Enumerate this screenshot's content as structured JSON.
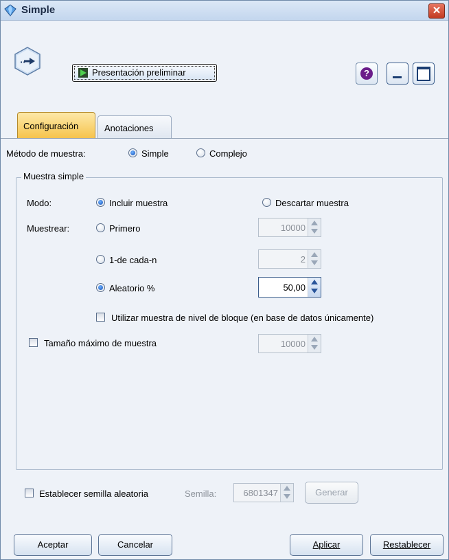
{
  "window": {
    "title": "Simple"
  },
  "toolbar": {
    "preview_label": "Presentación preliminar",
    "help_symbol": "?"
  },
  "tabs": [
    {
      "label": "Configuración",
      "active": true
    },
    {
      "label": "Anotaciones",
      "active": false
    }
  ],
  "method": {
    "label": "Método de muestra:",
    "options": [
      "Simple",
      "Complejo"
    ],
    "selected": "Simple"
  },
  "simple_sample": {
    "group_title": "Muestra simple",
    "mode_label": "Modo:",
    "mode_include": "Incluir muestra",
    "mode_discard": "Descartar muestra",
    "sample_label": "Muestrear:",
    "first_label": "Primero",
    "first_value": "10000",
    "nth_label": "1-de cada-n",
    "nth_value": "2",
    "random_label": "Aleatorio %",
    "random_value": "50,00",
    "block_level_label": "Utilizar muestra de nivel de bloque (en base de datos únicamente)",
    "max_size_label": "Tamaño máximo de muestra",
    "max_size_value": "10000"
  },
  "seed": {
    "checkbox_label": "Establecer semilla aleatoria",
    "seed_label": "Semilla:",
    "seed_value": "6801347",
    "generate_label": "Generar"
  },
  "buttons": {
    "accept": "Aceptar",
    "cancel": "Cancelar",
    "apply": "Aplicar",
    "reset": "Restablecer"
  },
  "icons": {
    "app": "diamond-app-icon",
    "node": "sample-node-icon",
    "preview": "play-icon",
    "help": "help-icon",
    "minimize": "minimize-icon",
    "maximize": "maximize-icon",
    "close": "close-icon"
  },
  "colors": {
    "active_tab": "#f6c24a",
    "close_button": "#c23b22",
    "radio_selected": "#1450b8",
    "help_icon": "#6b1d8a"
  }
}
